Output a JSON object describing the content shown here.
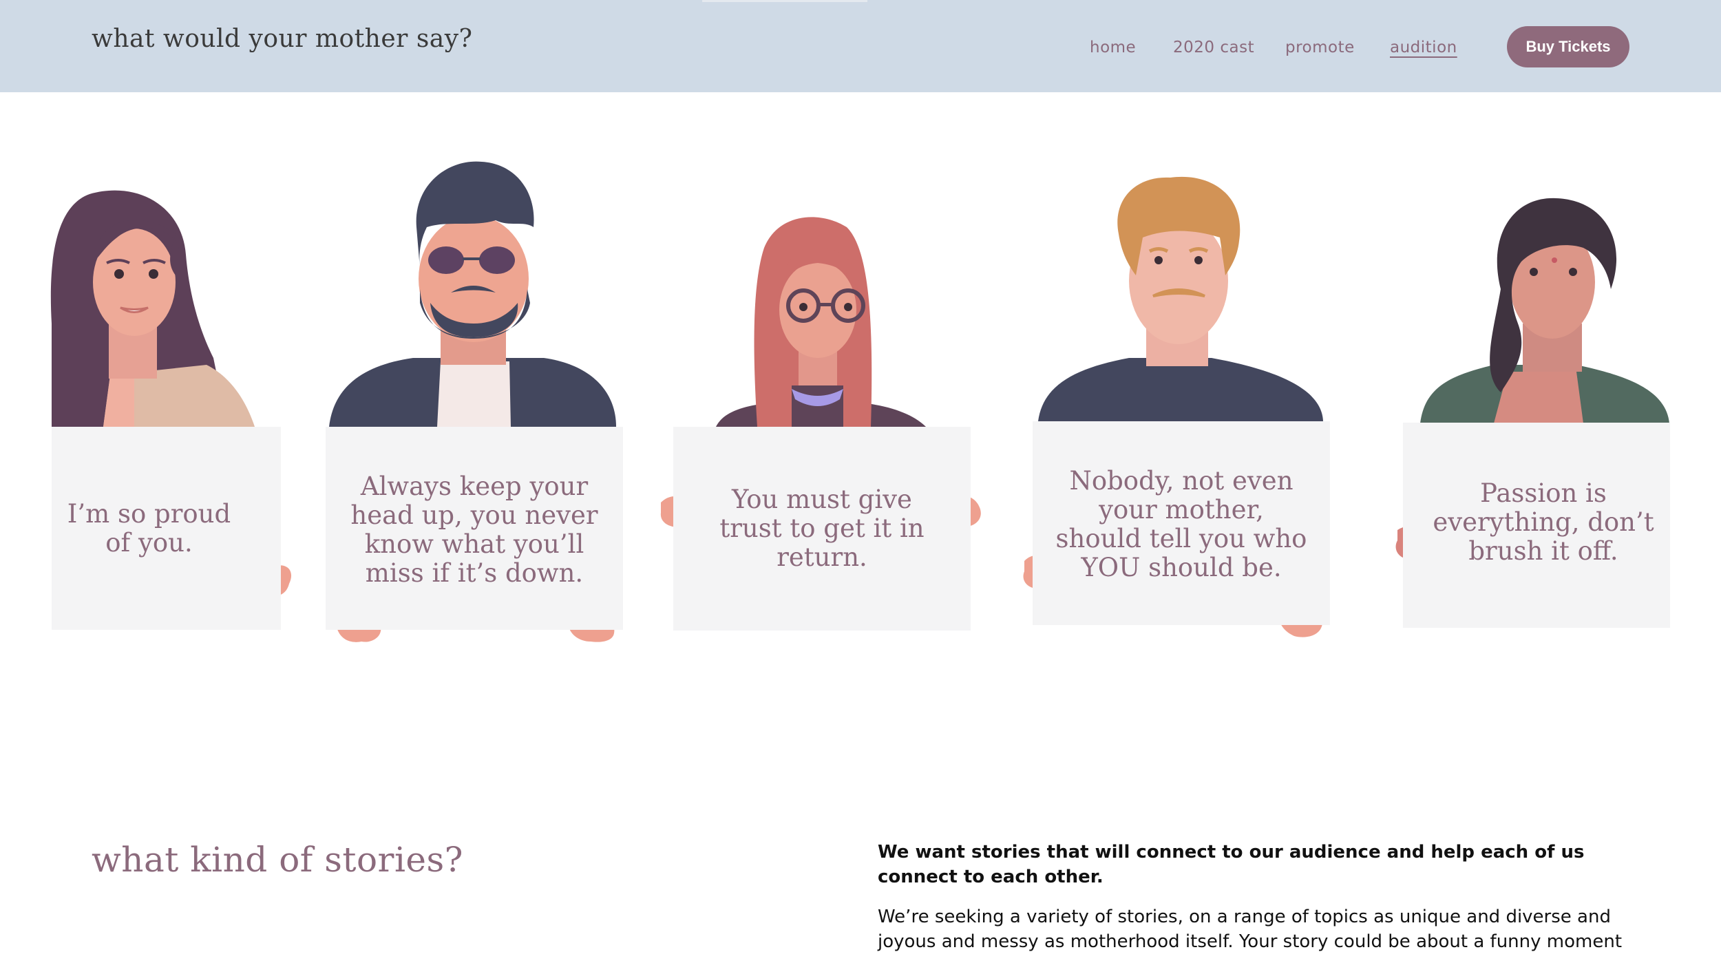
{
  "header": {
    "site_title": "what would your mother say?",
    "nav": {
      "home": "home",
      "cast": "2020 cast",
      "promote": "promote",
      "audition": "audition"
    },
    "buy_label": "Buy Tickets"
  },
  "signs": [
    {
      "line1": "I’m so proud",
      "line2": "of you."
    },
    {
      "line1": "Always keep your",
      "line2": "head up, you never",
      "line3": "know what you’ll",
      "line4": "miss if it’s down."
    },
    {
      "line1": "You must give",
      "line2": "trust to get it in",
      "line3": "return."
    },
    {
      "line1": "Nobody, not even",
      "line2": "your mother,",
      "line3": "should tell you who",
      "line4": "YOU should be."
    },
    {
      "line1": "Passion is",
      "line2": "everything, don’t",
      "line3": "brush it off."
    }
  ],
  "stories": {
    "heading": "what kind of stories?",
    "lead": "We want stories that will connect to our audience and help each of us connect to each other.",
    "body": "We’re seeking a variety of stories, on a range of topics as unique and diverse and joyous and messy as motherhood itself. Your story could be about a funny moment"
  },
  "colors": {
    "header_bg": "#cfdae6",
    "accent": "#8f6a7c",
    "sign_bg": "#f4f4f5"
  }
}
